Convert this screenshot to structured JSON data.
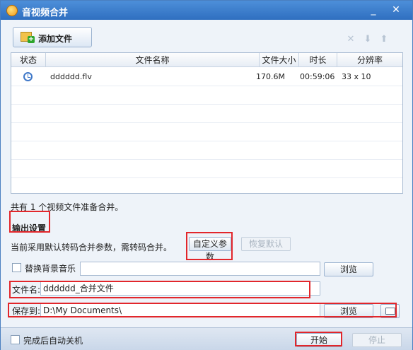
{
  "window": {
    "title": "音视频合并"
  },
  "toolbar": {
    "add_label": "添加文件"
  },
  "list": {
    "headers": [
      "状态",
      "文件名称",
      "文件大小",
      "时长",
      "分辨率"
    ],
    "rows": [
      {
        "status_icon": "clock-icon",
        "name": "dddddd.flv",
        "size": "170.6M",
        "duration": "00:59:06",
        "resolution": "33 x 10"
      }
    ]
  },
  "summary": {
    "count_text": "共有 1 个视频文件准备合并。"
  },
  "output": {
    "title": "输出设置",
    "hint": "当前采用默认转码合并参数，需转码合并。",
    "custom_label": "自定义参数",
    "restore_label": "恢复默认",
    "bgm_label": "替换背景音乐",
    "bgm_value": "",
    "browse_label": "浏览",
    "filename_label": "文件名:",
    "filename_value": "dddddd_合并文件",
    "save_label": "保存到:",
    "save_value": "D:\\My Documents\\",
    "browse2_label": "浏览"
  },
  "footer": {
    "shutdown_label": "完成后自动关机",
    "start_label": "开始",
    "stop_label": "停止"
  },
  "colors": {
    "titlebar": "#2f6fc0",
    "highlight": "#e2262b"
  }
}
